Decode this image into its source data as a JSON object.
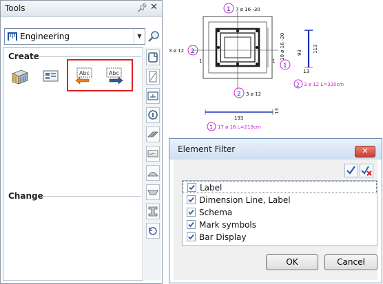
{
  "tools": {
    "title": "Tools",
    "pin_icon": "pin-icon",
    "close_icon": "close-icon",
    "dropdown": {
      "selected": "Engineering",
      "icon": "engineering-icon"
    },
    "search_icon": "search-icon",
    "sections": {
      "create": "Create",
      "change": "Change"
    },
    "create_tools": [
      "wall-3d-icon",
      "bar-schedule-icon",
      "label-left-icon",
      "label-right-icon"
    ],
    "side_tools": [
      "reinforcement-icon",
      "bar-shape-icon",
      "placement-icon",
      "pin-icon",
      "mesh-icon",
      "edit-label-icon",
      "cap-icon",
      "tray-icon",
      "beam-icon",
      "rotate-icon"
    ],
    "highlight_color": "#e02020"
  },
  "drawing": {
    "color_magenta": "#d020d0",
    "color_blue": "#1a2ebd",
    "top_mark": "1",
    "top_label": "7 ø 16 -30",
    "left_mark": "2",
    "left_label": "3 ø 12",
    "right_label": "10 ø 16 -20",
    "right_mark": "1",
    "bottom_mark": "2",
    "bottom_label": "3 ø 12",
    "one_left": "1",
    "one_right": "1",
    "dim_93": "93",
    "dim_113": "113",
    "dim_13": "13",
    "bar3_mark": "2",
    "bar3_label": "3 ø 12 L=320cm",
    "dim_193": "193",
    "dim_13b": "13",
    "bar1_mark": "1",
    "bar1_label": "17 ø 16 L=219cm"
  },
  "dialog": {
    "title": "Element Filter",
    "close_icon": "close-icon",
    "check_all_icon": "check-all-icon",
    "uncheck_all_icon": "uncheck-all-icon",
    "items": [
      {
        "label": "Label",
        "checked": true
      },
      {
        "label": "Dimension Line, Label",
        "checked": true
      },
      {
        "label": "Schema",
        "checked": true
      },
      {
        "label": "Mark symbols",
        "checked": true
      },
      {
        "label": "Bar Display",
        "checked": true
      }
    ],
    "ok_label": "OK",
    "cancel_label": "Cancel"
  }
}
